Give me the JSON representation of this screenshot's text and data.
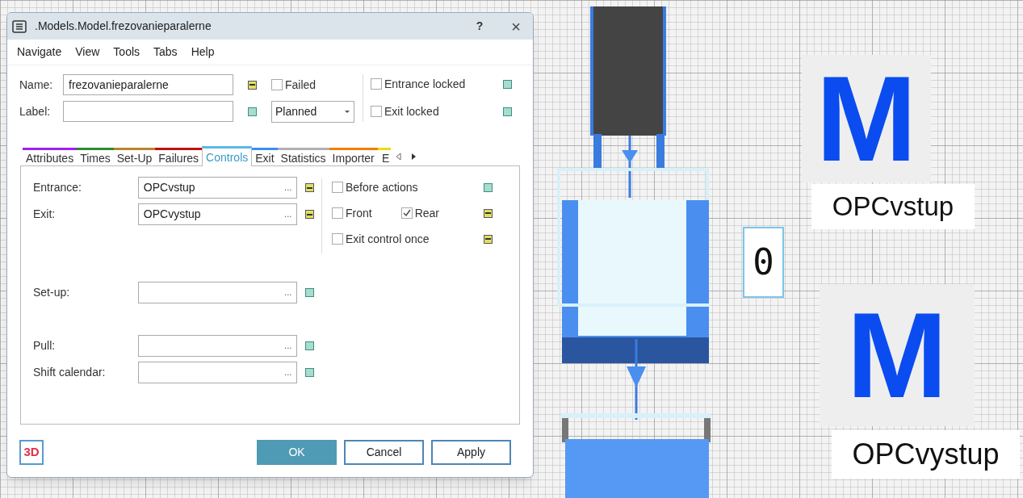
{
  "window": {
    "title": ".Models.Model.frezovanieparalerne",
    "help": "?",
    "close": "×"
  },
  "menu": [
    "Navigate",
    "View",
    "Tools",
    "Tabs",
    "Help"
  ],
  "header": {
    "name": {
      "label": "Name:",
      "value": "frezovanieparalerne",
      "inherited": false
    },
    "label_field": {
      "label": "Label:",
      "inherited": true
    },
    "failed": {
      "label": "Failed",
      "checked": false
    },
    "state_dropdown": {
      "value": "Planned"
    },
    "locks": [
      {
        "label": "Entrance locked",
        "checked": false,
        "inherited": true
      },
      {
        "label": "Exit locked",
        "checked": false,
        "inherited": true
      }
    ]
  },
  "tabs": [
    {
      "label": "Attributes",
      "color": "#a020f0",
      "selected": false
    },
    {
      "label": "Times",
      "color": "#2e8b2e",
      "selected": false
    },
    {
      "label": "Set-Up",
      "color": "#b8862b",
      "selected": false
    },
    {
      "label": "Failures",
      "color": "#c01010",
      "selected": false
    },
    {
      "label": "Controls",
      "color": "#5bb8e8",
      "selected": true
    },
    {
      "label": "Exit",
      "color": "#3a8ff0",
      "selected": false
    },
    {
      "label": "Statistics",
      "color": "#b0b0b0",
      "selected": false
    },
    {
      "label": "Importer",
      "color": "#f08000",
      "selected": false
    },
    {
      "label": "E",
      "color": "#e8e000",
      "selected": false
    }
  ],
  "controls": [
    [
      {
        "label": "Entrance:",
        "value": "OPCvstup",
        "button": "...",
        "inherited": false
      },
      {
        "label": "Exit:",
        "value": "OPCvystup",
        "button": "...",
        "inherited": false
      }
    ],
    [
      {
        "label": "Set-up:",
        "button": "...",
        "inherited": true
      }
    ],
    [
      {
        "label": "Pull:",
        "button": "...",
        "inherited": true
      },
      {
        "label": "Shift calendar:",
        "button": "...",
        "inherited": true
      }
    ]
  ],
  "options": [
    {
      "checkboxes": [
        {
          "label": "Before actions",
          "checked": false
        }
      ],
      "inherited": true
    },
    {
      "checkboxes": [
        {
          "label": "Front",
          "checked": false
        },
        {
          "label": "Rear",
          "checked": true
        }
      ],
      "inherited": false
    },
    {
      "checkboxes": [
        {
          "label": "Exit control once",
          "checked": false
        }
      ],
      "inherited": false
    }
  ],
  "badge_3d": "3D",
  "buttons": [
    {
      "label": "OK",
      "primary": true
    },
    {
      "label": "Cancel",
      "primary": false
    },
    {
      "label": "Apply",
      "primary": false
    }
  ],
  "scene": {
    "sources": [
      {
        "letter": "M",
        "label": "OPCvstup"
      },
      {
        "letter": "M",
        "label": "OPCvystup"
      }
    ],
    "counter": "0"
  }
}
